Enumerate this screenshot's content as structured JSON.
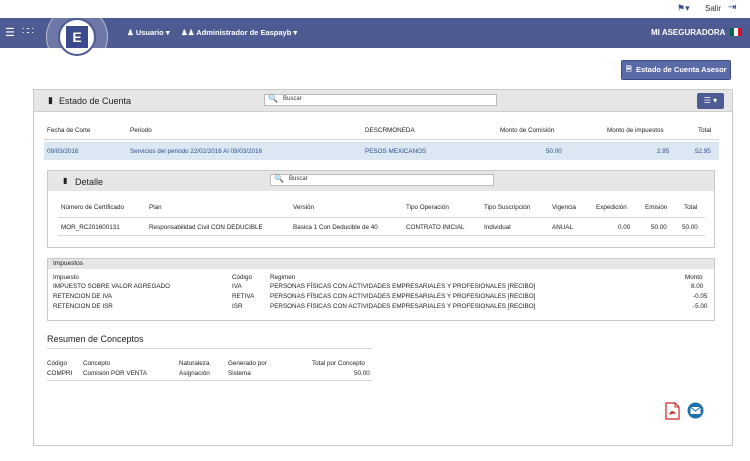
{
  "topbar": {
    "flag_icon": "flag-icon",
    "exit_label": "Salir",
    "exit_icon": "logout-icon"
  },
  "nav": {
    "menu_icon": "hamburger-icon",
    "apps_icon": "grid-icon",
    "usuario_label": "Usuario",
    "admin_label": "Administrador de Easpayb",
    "company": "MI ASEGURADORA",
    "logo_letter": "E"
  },
  "action": {
    "estado_button": "Estado de Cuenta Asesor"
  },
  "cuenta": {
    "title": "Estado de Cuenta",
    "search_placeholder": "Buscar",
    "headers": [
      "Fecha de Corte",
      "Periodo",
      "DESCRMONEDA",
      "Monto de Comisión",
      "Monto de impuestos",
      "Total"
    ],
    "row": [
      "09/03/2016",
      "Servicios del periodo 22/02/2016 Al 09/03/2016",
      "PESOS MEXICANOS",
      "50.00",
      "2.95",
      "52.95"
    ]
  },
  "detalle": {
    "title": "Detalle",
    "search_placeholder": "Buscar",
    "headers": [
      "Número de Certificado",
      "Plan",
      "Versión",
      "Tipo Operación",
      "Tipo Suscripción",
      "Vigencia",
      "Expedición",
      "Emisión",
      "Total"
    ],
    "row": [
      "MOR_RC201600131",
      "Responsabilidad Civil CON DEDUCIBLE",
      "Basica 1 Con Deducible de 40",
      "CONTRATO INICIAL",
      "Individual",
      "ANUAL",
      "0.00",
      "50.00",
      "50.00"
    ]
  },
  "impuestos": {
    "title": "Impuestos",
    "headers": [
      "Impuesto",
      "Código",
      "Regimen",
      "Monto"
    ],
    "rows": [
      [
        "IMPUESTO SOBRE VALOR AGREGADO",
        "IVA",
        "PERSONAS FÍSICAS CON ACTIVIDADES EMPRESARIALES Y PROFESIONALES [RECIBO]",
        "8.00"
      ],
      [
        "RETENCION DE IVA",
        "RETIVA",
        "PERSONAS FÍSICAS CON ACTIVIDADES EMPRESARIALES Y PROFESIONALES [RECIBO]",
        "-0.05"
      ],
      [
        "RETENCION DE ISR",
        "ISR",
        "PERSONAS FÍSICAS CON ACTIVIDADES EMPRESARIALES Y PROFESIONALES [RECIBO]",
        "-5.00"
      ]
    ]
  },
  "resumen": {
    "title": "Resumen de Conceptos",
    "headers": [
      "Código",
      "Concepto",
      "Naturaleza",
      "Generado por",
      "Total por Concepto"
    ],
    "row": [
      "COMPRI",
      "Comisión POR VENTA",
      "Asignación",
      "Sistema",
      "50.00"
    ]
  },
  "exports": {
    "pdf_icon": "pdf-icon",
    "email_icon": "email-icon"
  },
  "colors": {
    "navbar": "#4e5b93",
    "highlight": "#dbe7f3",
    "panel_header": "#e6e6e6"
  }
}
